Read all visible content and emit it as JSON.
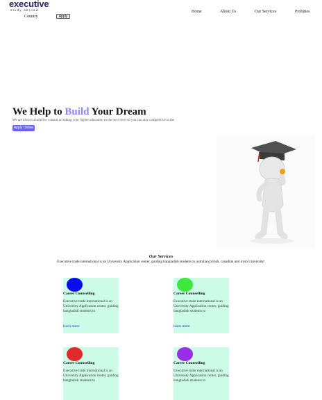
{
  "logo": {
    "main": "executive",
    "sub": "study abroad"
  },
  "header": {
    "country_label": "Country",
    "apply_label": "Apply"
  },
  "nav": {
    "items": [
      "Home",
      "About Us",
      "Our Services",
      "Probities"
    ]
  },
  "hero": {
    "title_prefix": "We Help to ",
    "title_accent": "Build",
    "title_suffix": " Your Dream",
    "subtitle": "We are always availed to consult on taking your higher education to the next level so you can stay competitive in the",
    "button_label": "Apply Online"
  },
  "services": {
    "title": "Our Services",
    "subtitle": "Executive trade international is an University Application center, guiding bangladish students to autralian,british, canadian and irysh University!",
    "cards": [
      {
        "title": "Career Counselling",
        "text": "Executive trade international is an University Application center, guiding bangladish students to",
        "link": "learn more",
        "color": "#0b0bf0"
      },
      {
        "title": "Career Counselling",
        "text": "Executive trade international is an University Application center, guiding bangladish students to",
        "link": "learn more",
        "color": "#3ee83e"
      },
      {
        "title": "Career Counselling",
        "text": "Executive trade international is an University Application center, guiding bangladish students to",
        "link": "",
        "color": "#e02a2a"
      },
      {
        "title": "Career Counselling",
        "text": "Executive trade international is an University Application center, guiding bangladish students to",
        "link": "",
        "color": "#9a2ee8"
      }
    ]
  },
  "colors": {
    "accent": "#8c86ee",
    "button": "#6b63f0",
    "card_bg": "#ccfce8"
  }
}
